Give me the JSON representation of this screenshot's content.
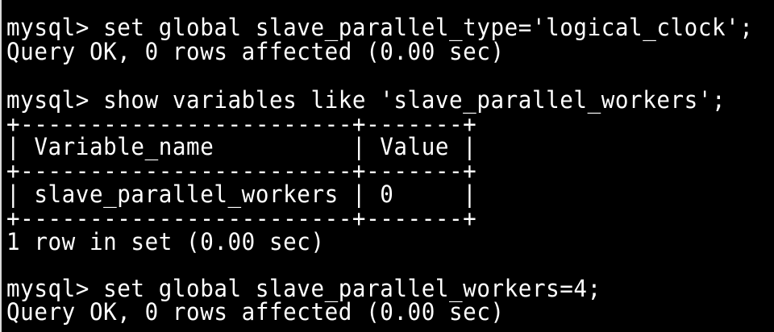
{
  "terminal": {
    "lines": [
      "mysql> set global slave_parallel_type='logical_clock';",
      "Query OK, 0 rows affected (0.00 sec)",
      "",
      "mysql> show variables like 'slave_parallel_workers';",
      "+------------------------+-------+",
      "| Variable_name          | Value |",
      "+------------------------+-------+",
      "| slave_parallel_workers | 0     |",
      "+------------------------+-------+",
      "1 row in set (0.00 sec)",
      "",
      "mysql> set global slave_parallel_workers=4;",
      "Query OK, 0 rows affected (0.00 sec)"
    ]
  },
  "colors": {
    "background": "#000000",
    "text": "#ffffff"
  }
}
